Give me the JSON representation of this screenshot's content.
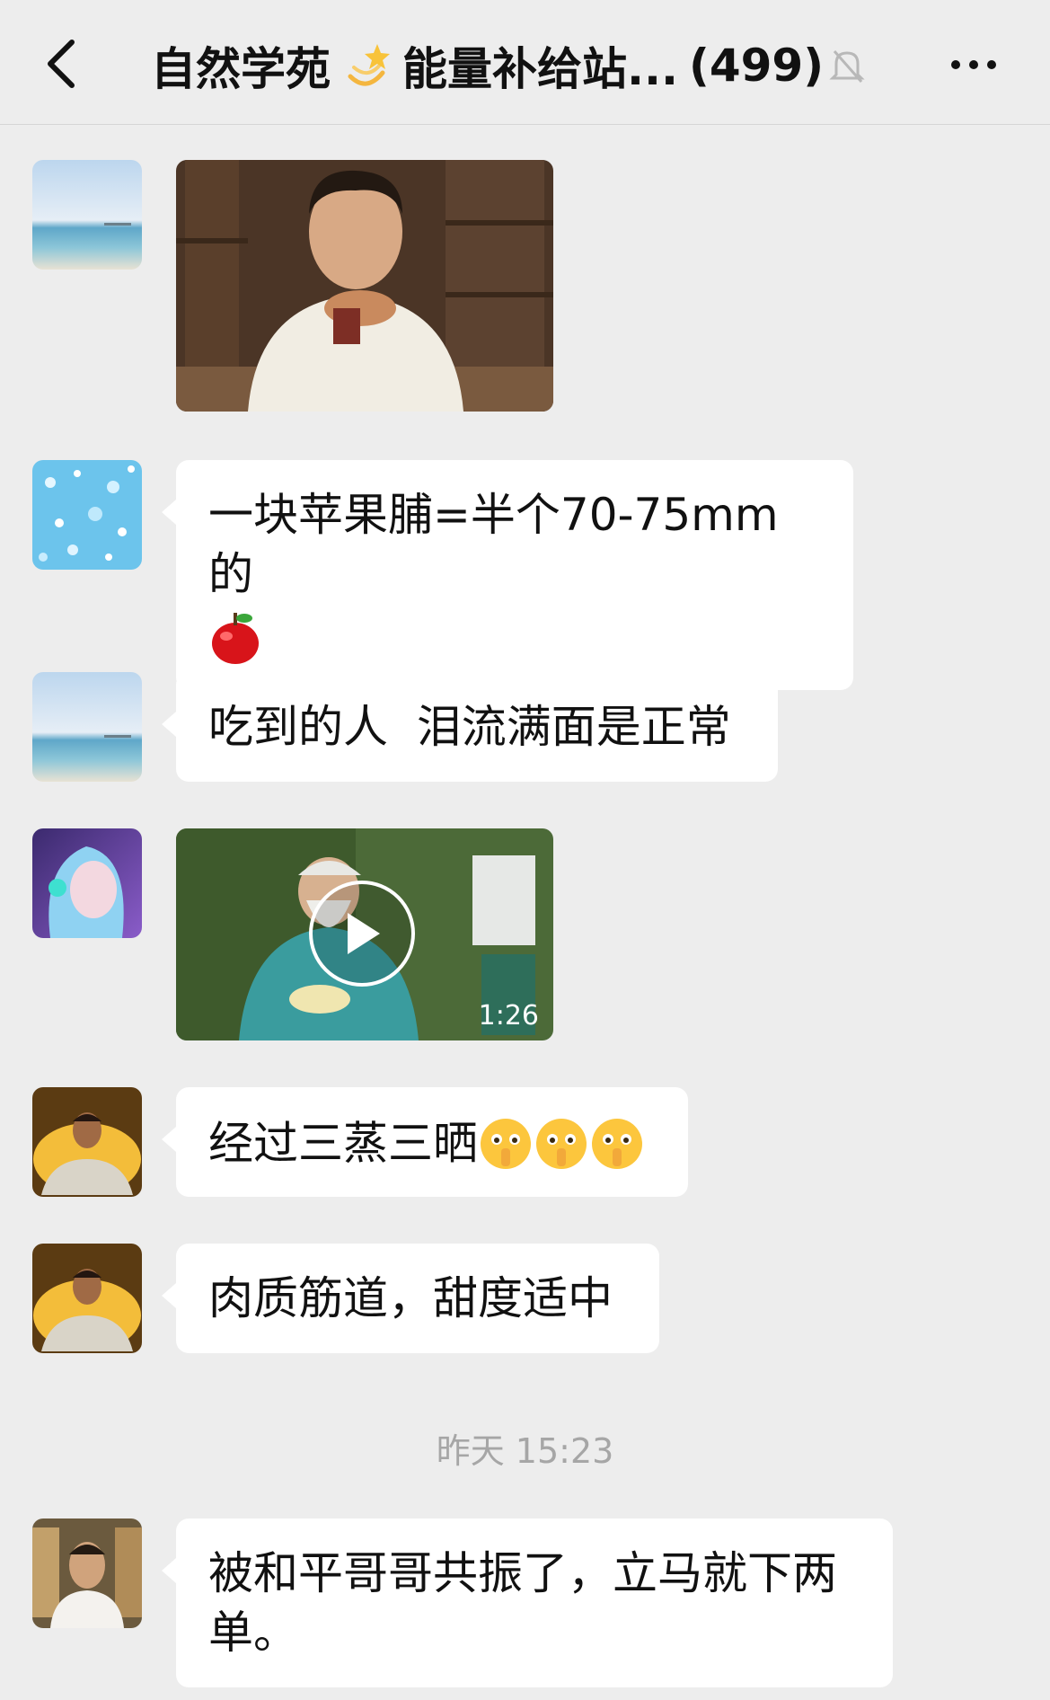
{
  "header": {
    "title_left": "自然学苑",
    "title_right": "能量补给站...",
    "member_count": "(499)",
    "icons": {
      "back": "back-chevron-icon",
      "title_emoji": "dizzy-star-icon",
      "mute": "bell-muted-icon",
      "more": "more-dots-icon"
    }
  },
  "messages": [
    {
      "type": "image",
      "avatar": "beach-avatar"
    },
    {
      "type": "text",
      "avatar": "sparkle-avatar",
      "text": "一块苹果脯=半个70-75mm的",
      "emoji": "red-apple-icon"
    },
    {
      "type": "text",
      "avatar": "beach-avatar",
      "text": "吃到的人  泪流满面是正常"
    },
    {
      "type": "video",
      "avatar": "anime-girl-avatar",
      "duration": "1:26"
    },
    {
      "type": "text",
      "avatar": "winged-man-avatar",
      "text": "经过三蒸三晒",
      "emoji": "shushing-face-icon"
    },
    {
      "type": "text",
      "avatar": "winged-man-avatar",
      "text": "肉质筋道，甜度适中"
    },
    {
      "type": "text",
      "avatar": "man-bookshelf-avatar",
      "text": "被和平哥哥共振了，立马就下两单。"
    }
  ],
  "timestamp": "昨天 15:23",
  "colors": {
    "background": "#ededed",
    "bubble": "#ffffff",
    "timestamp": "#a6a6a6"
  }
}
